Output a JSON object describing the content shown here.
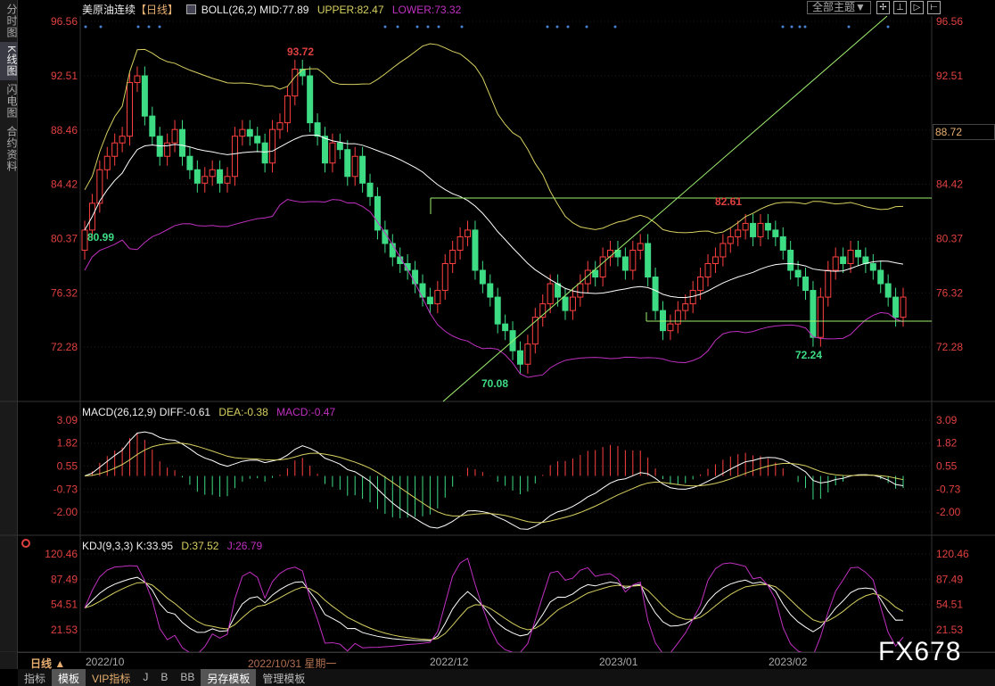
{
  "sidebar": {
    "tabs": [
      "分时图",
      "K线图",
      "闪电图",
      "合约资料"
    ],
    "active": 1
  },
  "header": {
    "instrument": "美原油连续",
    "period": "【日线】",
    "boll": "BOLL(26,2)",
    "mid": "MID:77.89",
    "upper": "UPPER:82.47",
    "lower": "LOWER:73.32"
  },
  "toolbar": {
    "theme": "全部主题▼",
    "buttons": [
      "✢",
      "⊥",
      "▷",
      "⊢"
    ]
  },
  "macd_header": {
    "name": "MACD(26,12,9)",
    "diff": "DIFF:-0.61",
    "dea": "DEA:-0.38",
    "macd": "MACD:-0.47"
  },
  "kdj_header": {
    "name": "KDJ(9,3,3)",
    "k": "K:33.95",
    "d": "D:37.52",
    "j": "J:26.79"
  },
  "current_price": "88.72",
  "period_label": "日线 ▲",
  "dates": [
    "2022/10",
    "2022/10/31 星期一",
    "2022/12",
    "2023/01",
    "2023/02"
  ],
  "bottom_tabs": [
    "指标",
    "模板",
    "VIP指标",
    "J",
    "B",
    "BB",
    "另存模板",
    "管理模板"
  ],
  "bottom_active": [
    1,
    6
  ],
  "watermark": "FX678",
  "colors": {
    "up": "#ff4040",
    "down": "#3ddc84",
    "axis": "#e04040",
    "upper": "#d8d060",
    "lower": "#c030c0",
    "mid": "#ffffff"
  },
  "chart_data": [
    {
      "type": "candlestick",
      "title": "美原油连续 日线",
      "y_ticks": [
        "96.56",
        "92.51",
        "88.46",
        "84.42",
        "80.37",
        "76.32",
        "72.28"
      ],
      "ylim": [
        72.28,
        96.56
      ],
      "annotations": [
        "93.72",
        "80.99",
        "70.08",
        "82.61",
        "72.24"
      ],
      "close": [
        81.0,
        83.0,
        85.5,
        86.5,
        87.5,
        88.0,
        92.0,
        92.5,
        89.5,
        88.0,
        86.5,
        87.5,
        88.5,
        86.5,
        85.5,
        84.5,
        85.0,
        85.5,
        84.5,
        85.0,
        88.0,
        88.5,
        88.0,
        87.5,
        86.0,
        88.5,
        89.0,
        91.0,
        93.0,
        92.5,
        89.0,
        88.0,
        86.0,
        87.5,
        87.0,
        85.0,
        86.5,
        84.5,
        83.5,
        81.0,
        80.0,
        79.0,
        78.5,
        78.0,
        77.0,
        76.0,
        75.5,
        76.5,
        78.5,
        79.5,
        80.5,
        81.0,
        78.0,
        77.0,
        76.0,
        74.0,
        73.5,
        72.0,
        71.0,
        72.5,
        74.5,
        75.5,
        77.0,
        76.0,
        75.0,
        76.0,
        77.0,
        78.0,
        77.5,
        79.0,
        79.5,
        79.0,
        78.0,
        79.5,
        80.0,
        77.5,
        75.0,
        73.5,
        74.0,
        75.0,
        75.5,
        76.5,
        77.5,
        78.5,
        79.0,
        80.0,
        80.5,
        81.0,
        81.5,
        80.5,
        81.5,
        81.0,
        80.5,
        79.5,
        78.0,
        77.5,
        76.5,
        73.0,
        76.0,
        78.0,
        79.0,
        78.5,
        79.5,
        79.0,
        78.5,
        78.0,
        77.0,
        76.0,
        74.5,
        76.0
      ]
    },
    {
      "type": "bar+line",
      "title": "MACD(26,12,9)",
      "y_ticks": [
        "3.09",
        "1.82",
        "0.55",
        "-0.73",
        "-2.00"
      ],
      "ylim": [
        -2.0,
        3.09
      ]
    },
    {
      "type": "line",
      "title": "KDJ(9,3,3)",
      "y_ticks": [
        "120.46",
        "87.49",
        "54.51",
        "21.53"
      ],
      "ylim": [
        21.53,
        120.46
      ]
    }
  ]
}
